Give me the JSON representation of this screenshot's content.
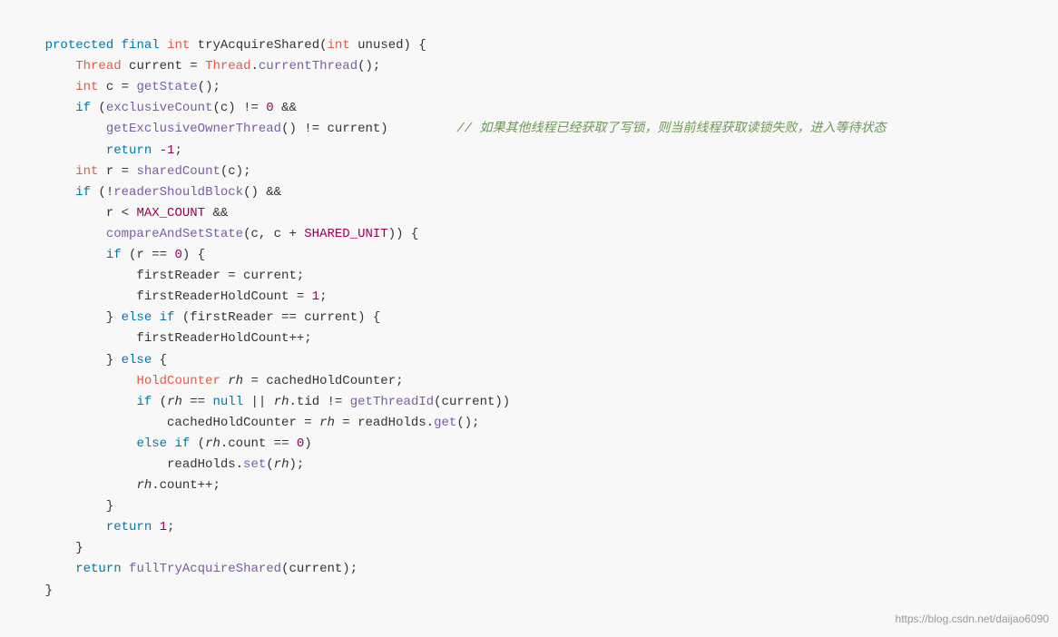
{
  "code": {
    "lines": [
      {
        "id": 1,
        "content": "protected_final_int_tryAcquireShared"
      },
      {
        "id": 2,
        "content": "Thread_current"
      },
      {
        "id": 3,
        "content": "int_c"
      },
      {
        "id": 4,
        "content": "if_exclusiveCount"
      },
      {
        "id": 5,
        "content": "getExclusiveOwnerThread"
      },
      {
        "id": 6,
        "content": "return_minus1"
      },
      {
        "id": 7,
        "content": "int_r"
      },
      {
        "id": 8,
        "content": "if_readerShouldBlock"
      },
      {
        "id": 9,
        "content": "r_lt_MAX_COUNT"
      },
      {
        "id": 10,
        "content": "compareAndSetState"
      }
    ],
    "watermark": "https://blog.csdn.net/daijao6090"
  }
}
